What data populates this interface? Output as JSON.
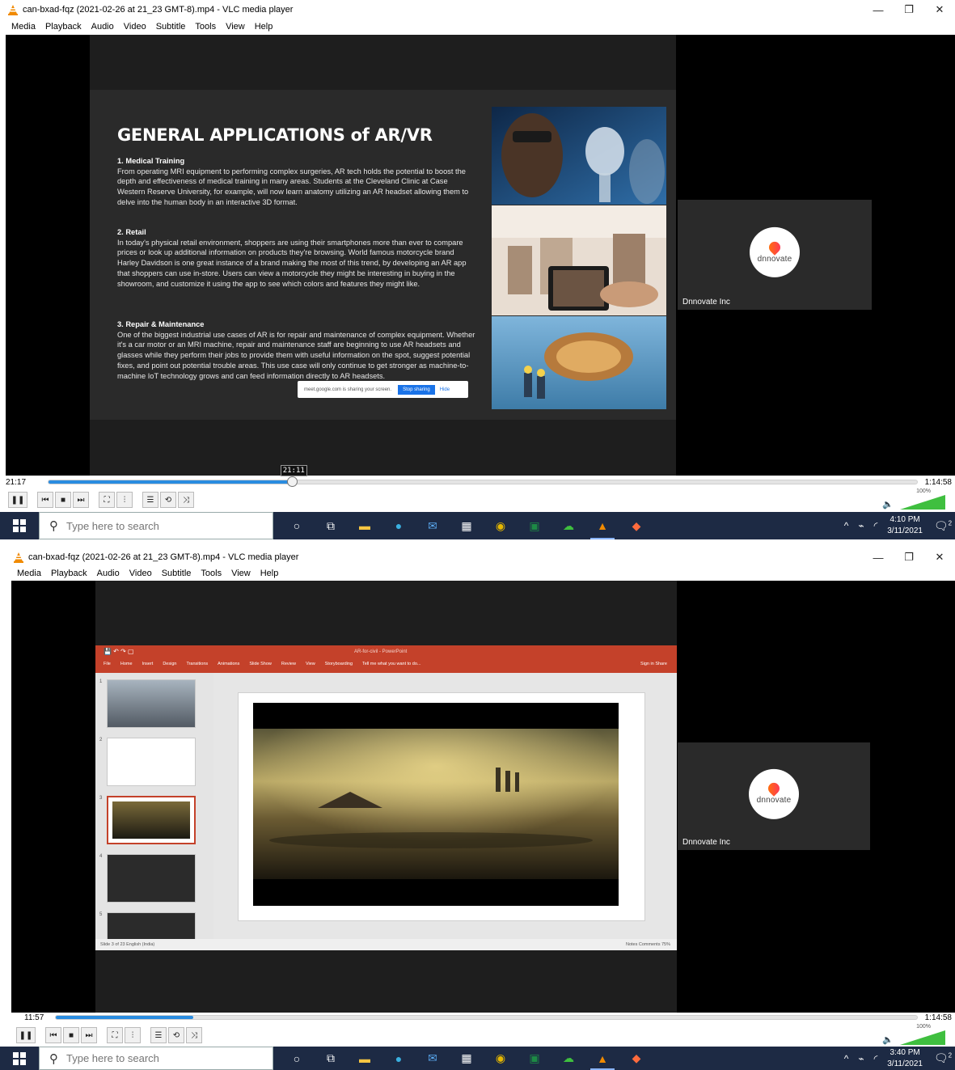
{
  "windows": [
    {
      "title": "can-bxad-fqz (2021-02-26 at 21_23 GMT-8).mp4 - VLC media player",
      "menu": [
        "Media",
        "Playback",
        "Audio",
        "Video",
        "Subtitle",
        "Tools",
        "View",
        "Help"
      ],
      "elapsed": "21:17",
      "total": "1:14:58",
      "seek_tooltip": "21:11",
      "progress": 0.28,
      "volume": "100%",
      "slide": {
        "heading": "GENERAL APPLICATIONS of AR/VR",
        "sections": [
          {
            "title": "1. Medical Training",
            "body": "From operating MRI equipment to performing complex surgeries, AR tech holds the potential to boost the depth and effectiveness of medical training in many areas. Students at the Cleveland Clinic at Case Western Reserve University, for example, will now learn anatomy utilizing an AR headset allowing them to delve into the human body in an interactive 3D format."
          },
          {
            "title": "2. Retail",
            "body": "In today's physical retail environment, shoppers are using their smartphones more than ever to compare prices or look up additional information on products they're browsing. World famous motorcycle brand Harley Davidson is one great instance of a brand making the most of this trend, by developing an AR app that shoppers can use in-store. Users can view a motorcycle they might be interesting in buying in the showroom, and customize it using the app to see which colors and features they might like."
          },
          {
            "title": "3. Repair & Maintenance",
            "body": "One of the biggest industrial use cases of AR is for repair and maintenance of complex equipment. Whether it's a car motor or an MRI machine, repair and maintenance staff are beginning to use AR headsets and glasses while they perform their jobs to provide them with useful information on the spot, suggest potential fixes, and point out potential trouble areas. This use case will only continue to get stronger as machine-to-machine IoT technology grows and can feed information directly to AR headsets."
          }
        ],
        "share_text": "meet.google.com is sharing your screen.",
        "share_stop": "Stop sharing",
        "share_hide": "Hide"
      },
      "speaker_brand": "dnnovate",
      "speaker_name": "Dnnovate Inc",
      "taskbar": {
        "search_placeholder": "Type here to search",
        "time": "4:10 PM",
        "date": "3/11/2021",
        "notifications": "2"
      }
    },
    {
      "title": "can-bxad-fqz (2021-02-26 at 21_23 GMT-8).mp4 - VLC media player",
      "menu": [
        "Media",
        "Playback",
        "Audio",
        "Video",
        "Subtitle",
        "Tools",
        "View",
        "Help"
      ],
      "elapsed": "11:57",
      "total": "1:14:58",
      "progress": 0.16,
      "volume": "100%",
      "ppt": {
        "doc_title": "AR-for-civil - PowerPoint",
        "tabs": [
          "File",
          "Home",
          "Insert",
          "Design",
          "Transitions",
          "Animations",
          "Slide Show",
          "Review",
          "View",
          "Storyboarding",
          "Tell me what you want to do..."
        ],
        "account": "Sign in   Share",
        "status_left": "Slide 3 of 23   English (India)",
        "status_right": "Notes   Comments   75%",
        "thumb_nums": [
          "1",
          "2",
          "3",
          "4",
          "5"
        ]
      },
      "speaker_brand": "dnnovate",
      "speaker_name": "Dnnovate Inc",
      "taskbar": {
        "search_placeholder": "Type here to search",
        "time": "3:40 PM",
        "date": "3/11/2021",
        "notifications": "2"
      }
    }
  ]
}
